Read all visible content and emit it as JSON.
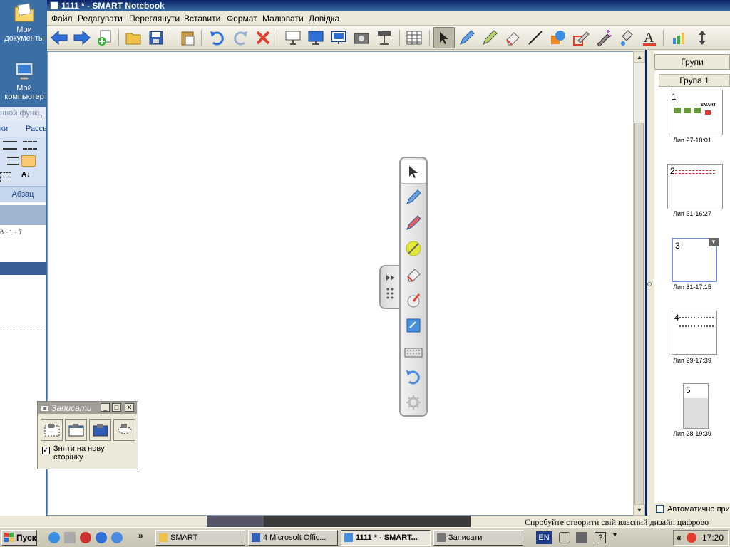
{
  "desktop": {
    "icons": [
      {
        "label": "Мои документы",
        "icon": "my-documents-icon"
      },
      {
        "label": "Мой компьютер",
        "icon": "my-computer-icon"
      }
    ]
  },
  "word_behind": {
    "line1": "нной функц",
    "line2_a": "ки",
    "line2_b": "Рассь",
    "group": "Абзац",
    "ruler": "6 · 1 · 7"
  },
  "window": {
    "title": "1111 * - SMART Notebook"
  },
  "menu": [
    "Файл",
    "Редагувати",
    "Переглянути",
    "Вставити",
    "Формат",
    "Малювати",
    "Довідка"
  ],
  "toolbar": {
    "icons": [
      "back-arrow-icon",
      "forward-arrow-icon",
      "add-page-icon",
      "open-folder-icon",
      "save-icon",
      "paste-icon",
      "undo-icon",
      "redo-icon",
      "delete-icon",
      "screen-shade-icon",
      "full-screen-icon",
      "dual-display-icon",
      "screen-capture-icon",
      "document-camera-icon",
      "table-icon",
      "select-arrow-icon",
      "pen-icon",
      "creative-pen-icon",
      "eraser-icon",
      "line-icon",
      "shape-icon",
      "shape-pen-icon",
      "magic-pen-icon",
      "fill-icon",
      "text-icon",
      "properties-icon",
      "move-toolbar-icon"
    ]
  },
  "side_panel": {
    "groups_button": "Групи",
    "group_label": "Група 1",
    "pages": [
      {
        "number": "1",
        "caption": "Лип 27-18:01"
      },
      {
        "number": "2",
        "caption": "Лип 31-16:27"
      },
      {
        "number": "3",
        "caption": "Лип 31-17:15"
      },
      {
        "number": "4",
        "caption": "Лип 29-17:39"
      },
      {
        "number": "5",
        "caption": "Лип 28-19:39"
      }
    ],
    "thumb1_text": "SMART",
    "auto_hide": "Автоматично при"
  },
  "floating_tools": {
    "icons": [
      "select-icon",
      "pen-icon",
      "creative-pen-icon",
      "highlighter-icon",
      "eraser-icon",
      "magic-eraser-icon",
      "notebook-icon",
      "keyboard-icon",
      "undo-icon",
      "settings-icon"
    ]
  },
  "record_dialog": {
    "title": "Записати",
    "checkbox_label": "Зняти на нову сторінку",
    "checked": true
  },
  "below_text": "Спробуйте створити свій власний дизайн цифрово",
  "taskbar": {
    "start": "Пуск",
    "tasks": [
      {
        "label": "SMART",
        "active": false
      },
      {
        "label": "4 Microsoft Offic...",
        "active": false
      },
      {
        "label": "1111 * - SMART...",
        "active": true
      },
      {
        "label": "Записати",
        "active": false
      }
    ],
    "lang": "EN",
    "clock": "17:20",
    "chevron": "»"
  },
  "colors": {
    "accent": "#0a246a",
    "desktop": "#3a6ea5"
  }
}
